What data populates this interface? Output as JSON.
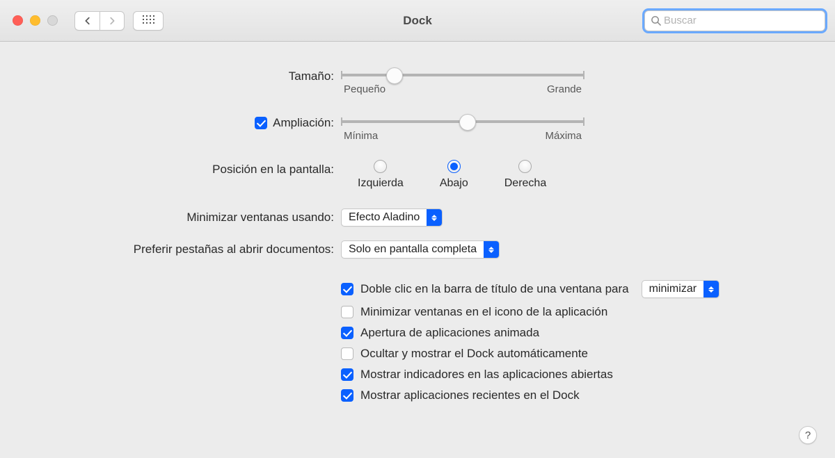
{
  "window": {
    "title": "Dock"
  },
  "toolbar": {
    "search_placeholder": "Buscar"
  },
  "size": {
    "label": "Tamaño:",
    "min_label": "Pequeño",
    "max_label": "Grande",
    "value_pct": 22
  },
  "magnification": {
    "label": "Ampliación:",
    "checked": true,
    "min_label": "Mínima",
    "max_label": "Máxima",
    "value_pct": 52
  },
  "position": {
    "label": "Posición en la pantalla:",
    "selected": "abajo",
    "left": "Izquierda",
    "bottom": "Abajo",
    "right": "Derecha"
  },
  "minimize_effect": {
    "label": "Minimizar ventanas usando:",
    "value": "Efecto Aladino"
  },
  "prefer_tabs": {
    "label": "Preferir pestañas al abrir documentos:",
    "value": "Solo en pantalla completa"
  },
  "double_click": {
    "checked": true,
    "label": "Doble clic en la barra de título de una ventana para",
    "value": "minimizar"
  },
  "options": {
    "minimize_into_icon": {
      "checked": false,
      "label": "Minimizar ventanas en el icono de la aplicación"
    },
    "animate_opening": {
      "checked": true,
      "label": "Apertura de aplicaciones animada"
    },
    "auto_hide": {
      "checked": false,
      "label": "Ocultar y mostrar el Dock automáticamente"
    },
    "show_indicators": {
      "checked": true,
      "label": "Mostrar indicadores en las aplicaciones abiertas"
    },
    "show_recents": {
      "checked": true,
      "label": "Mostrar aplicaciones recientes en el Dock"
    }
  },
  "help_glyph": "?"
}
